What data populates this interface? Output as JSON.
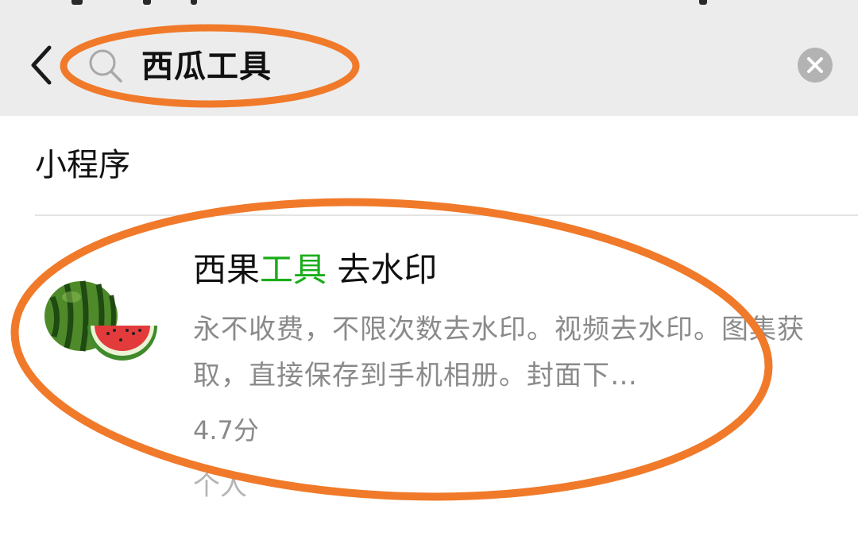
{
  "header": {
    "search_query": "西瓜工具",
    "back_icon": "chevron-left-icon",
    "search_icon": "search-icon",
    "clear_icon": "clear-circle-icon"
  },
  "section": {
    "title": "小程序"
  },
  "result": {
    "title_prefix": "西果",
    "title_highlight": "工具",
    "title_suffix": " 去水印",
    "description": "永不收费，不限次数去水印。视频去水印。图集获取，直接保存到手机相册。封面下…",
    "rating": "4.7分",
    "extra": "个人",
    "icon": "watermelon-icon"
  },
  "colors": {
    "header_bg": "#ececec",
    "highlight": "#1aad19",
    "annotation": "#f07a2a"
  }
}
